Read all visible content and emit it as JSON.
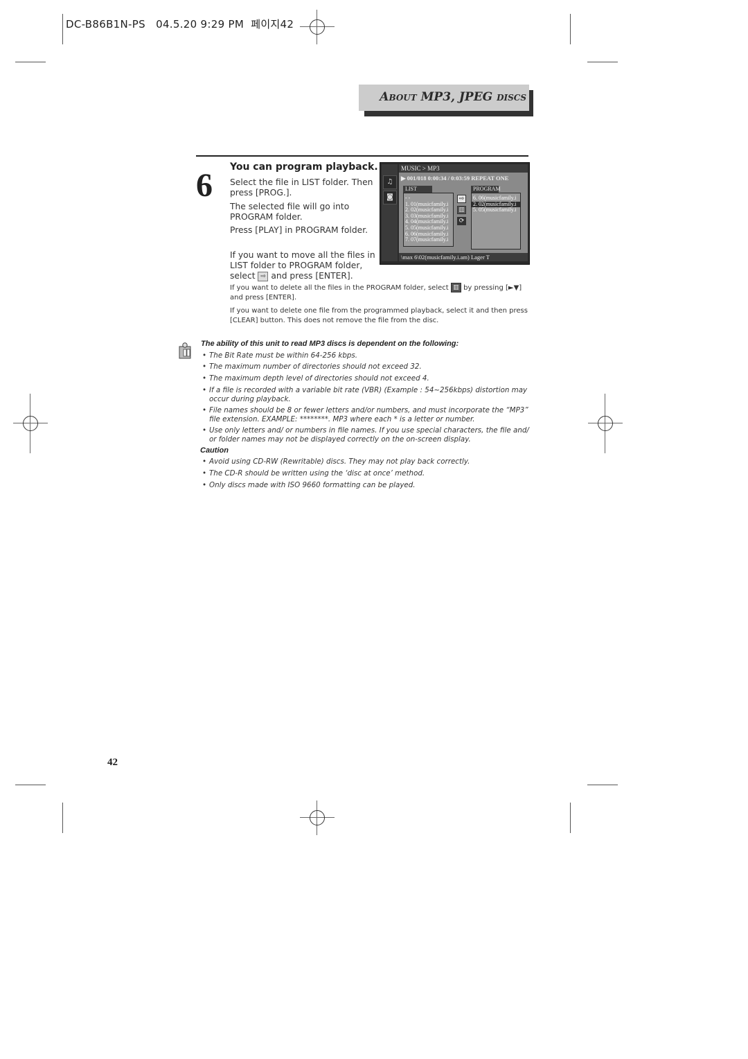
{
  "header": {
    "meta": "DC-B86B1N-PS   04.5.20 9:29 PM  페이지42"
  },
  "section_banner": {
    "prefix_cap": "A",
    "prefix_rest": "BOUT",
    "main": " MP3, JPEG ",
    "suffix_cap": "",
    "suffix_rest": "DISCS"
  },
  "step": {
    "number": "6",
    "title": "You can program playback.",
    "paragraphs": [
      "Select the file in LIST folder. Then press [PROG.].",
      "The selected file will go into PROGRAM folder.",
      "Press [PLAY] in PROGRAM folder.",
      "If you want to move all the files in LIST folder to PROGRAM folder,"
    ],
    "select_prefix": "select",
    "select_suffix": "and press [ENTER]."
  },
  "osd": {
    "path": "MUSIC > MP3",
    "status": "▶ 001/018 0:00:34 / 0:03:59    REPEAT ONE",
    "list_tab": "LIST",
    "program_tab": "PROGRAM",
    "list_items": [
      "- -",
      "1. 01(musicfamily.i",
      "2. 02(musicfamily.i",
      "3. 03(musicfamily.i",
      "4. 04(musicfamily.i",
      "5. 05(musicfamily.i",
      "6. 06(musicfamily.i",
      "7. 07(musicfamily.i"
    ],
    "program_items": [
      "6. 06(musicfamily.i",
      "2. 02(musicfamily.i",
      "5. 05(musicfamily.i"
    ],
    "program_selected_index": 1,
    "footer": "\\max 6\\02(musicfamily.i.am)   Lager T",
    "side_icons": [
      "music-note-icon",
      "photo-icon"
    ],
    "mid_buttons": [
      "move-all-arrow-icon",
      "trash-icon",
      "repeat-icon"
    ]
  },
  "notes_small": {
    "delete_all_prefix": "If you want to delete all the files in the PROGRAM folder, select",
    "delete_all_suffix": "by pressing [►▼] and press [ENTER].",
    "delete_one": "If you want to delete one file from the programmed playback, select it and then press [CLEAR] button. This does not remove the file from the disc."
  },
  "note": {
    "heading": "The ability of this unit to read MP3 discs is dependent on the following:",
    "bullets": [
      "The Bit Rate must be within 64-256 kbps.",
      "The maximum number of directories should not exceed 32.",
      "The maximum depth level of directories should not exceed 4.",
      "If a file is recorded with a variable bit rate (VBR) (Example : 54~256kbps) distortion may occur during playback.",
      "File names should be 8 or fewer letters and/or numbers, and must incorporate the “MP3” file extension. EXAMPLE: ********. MP3 where each * is a letter or number.",
      "Use only letters and/ or numbers in file names. If you use special characters, the file and/ or folder names may not be displayed correctly on the on-screen display."
    ]
  },
  "caution": {
    "label": "Caution",
    "bullets": [
      "Avoid using CD-RW (Rewritable) discs. They may not play back correctly.",
      "The CD-R should be written using the ‘disc at once’ method.",
      "Only discs made with ISO 9660 formatting can be played."
    ]
  },
  "footer": {
    "page_number": "42"
  }
}
